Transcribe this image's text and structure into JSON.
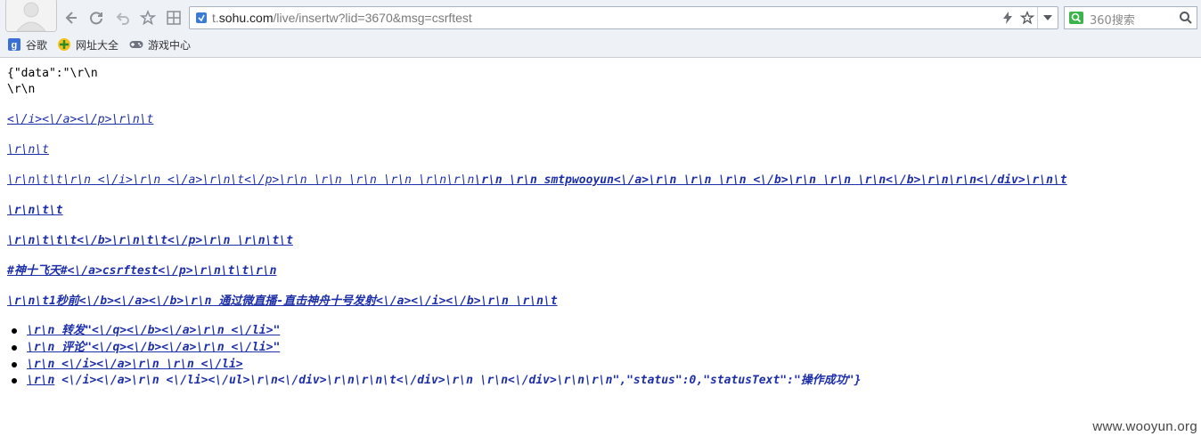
{
  "toolbar": {
    "avatar_icon": "user-avatar-icon",
    "back_icon": "back-arrow-icon",
    "refresh_icon": "refresh-icon",
    "undo_icon": "undo-arrow-icon",
    "favorite_icon": "star-icon",
    "apps_icon": "grid-icon"
  },
  "address_bar": {
    "url_prefix": "t.",
    "url_host": "sohu.com",
    "url_path": "/live/insertw?lid=3670&msg=csrftest",
    "lightning_icon": "lightning-icon",
    "star_icon": "star-outline-icon",
    "dropdown_icon": "chevron-down-icon"
  },
  "search": {
    "placeholder": "360搜索",
    "logo_icon": "360-search-logo-icon",
    "search_icon": "search-icon"
  },
  "bookmarks": [
    {
      "label": "谷歌",
      "icon": "google-icon"
    },
    {
      "label": "网址大全",
      "icon": "web-directory-icon"
    },
    {
      "label": "游戏中心",
      "icon": "gamepad-icon"
    }
  ],
  "content": {
    "line1": "{\"data\":\"\\r\\n",
    "line2": "\\r\\n",
    "link1": "<\\/i><\\/a><\\/p>\\r\\n\\t",
    "link2": "\\r\\n\\t",
    "link3_plain": "\\r\\n\\t\\t\\r\\n <\\/i>\\r\\n <\\/a>\\r\\n\\t<\\/p>\\r\\n \\r\\n \\r\\n \\r\\n \\r\\n\\r\\n",
    "link3_bold": "\\r\\n \\r\\n smtpwooyun<\\/a>\\r\\n \\r\\n \\r\\n <\\/b>\\r\\n \\r\\n \\r\\n<\\/b>\\r\\n\\r\\n<\\/div>\\r\\n\\t",
    "link4": "\\r\\n\\t\\t",
    "link5": "\\r\\n\\t\\t\\t<\\/b>\\r\\n\\t\\t<\\/p>\\r\\n \\r\\n\\t\\t",
    "link6": "#神十飞天#<\\/a>csrftest<\\/p>\\r\\n\\t\\t\\r\\n",
    "link7": "\\r\\n\\t1秒前<\\/b><\\/a><\\/b>\\r\\n 通过微直播-直击神舟十号发射<\\/a><\\/i><\\/b>\\r\\n \\r\\n\\t",
    "list_items": [
      {
        "link": "\\r\\n 转发\"<\\/q><\\/b><\\/a>\\r\\n <\\/li>\"",
        "tail": ""
      },
      {
        "link": "\\r\\n 评论\"<\\/q><\\/b><\\/a>\\r\\n <\\/li>\"",
        "tail": ""
      },
      {
        "link": "\\r\\n <\\/i><\\/a>\\r\\n \\r\\n <\\/li>",
        "tail": ""
      },
      {
        "link": "\\r\\n",
        "tail": " <\\/i><\\/a>\\r\\n <\\/li><\\/ul>\\r\\n<\\/div>\\r\\n\\r\\n\\t<\\/div>\\r\\n \\r\\n<\\/div>\\r\\n\\r\\n\",\"status\":0,\"statusText\":\"操作成功\"}"
      }
    ]
  },
  "watermark": "www.wooyun.org"
}
